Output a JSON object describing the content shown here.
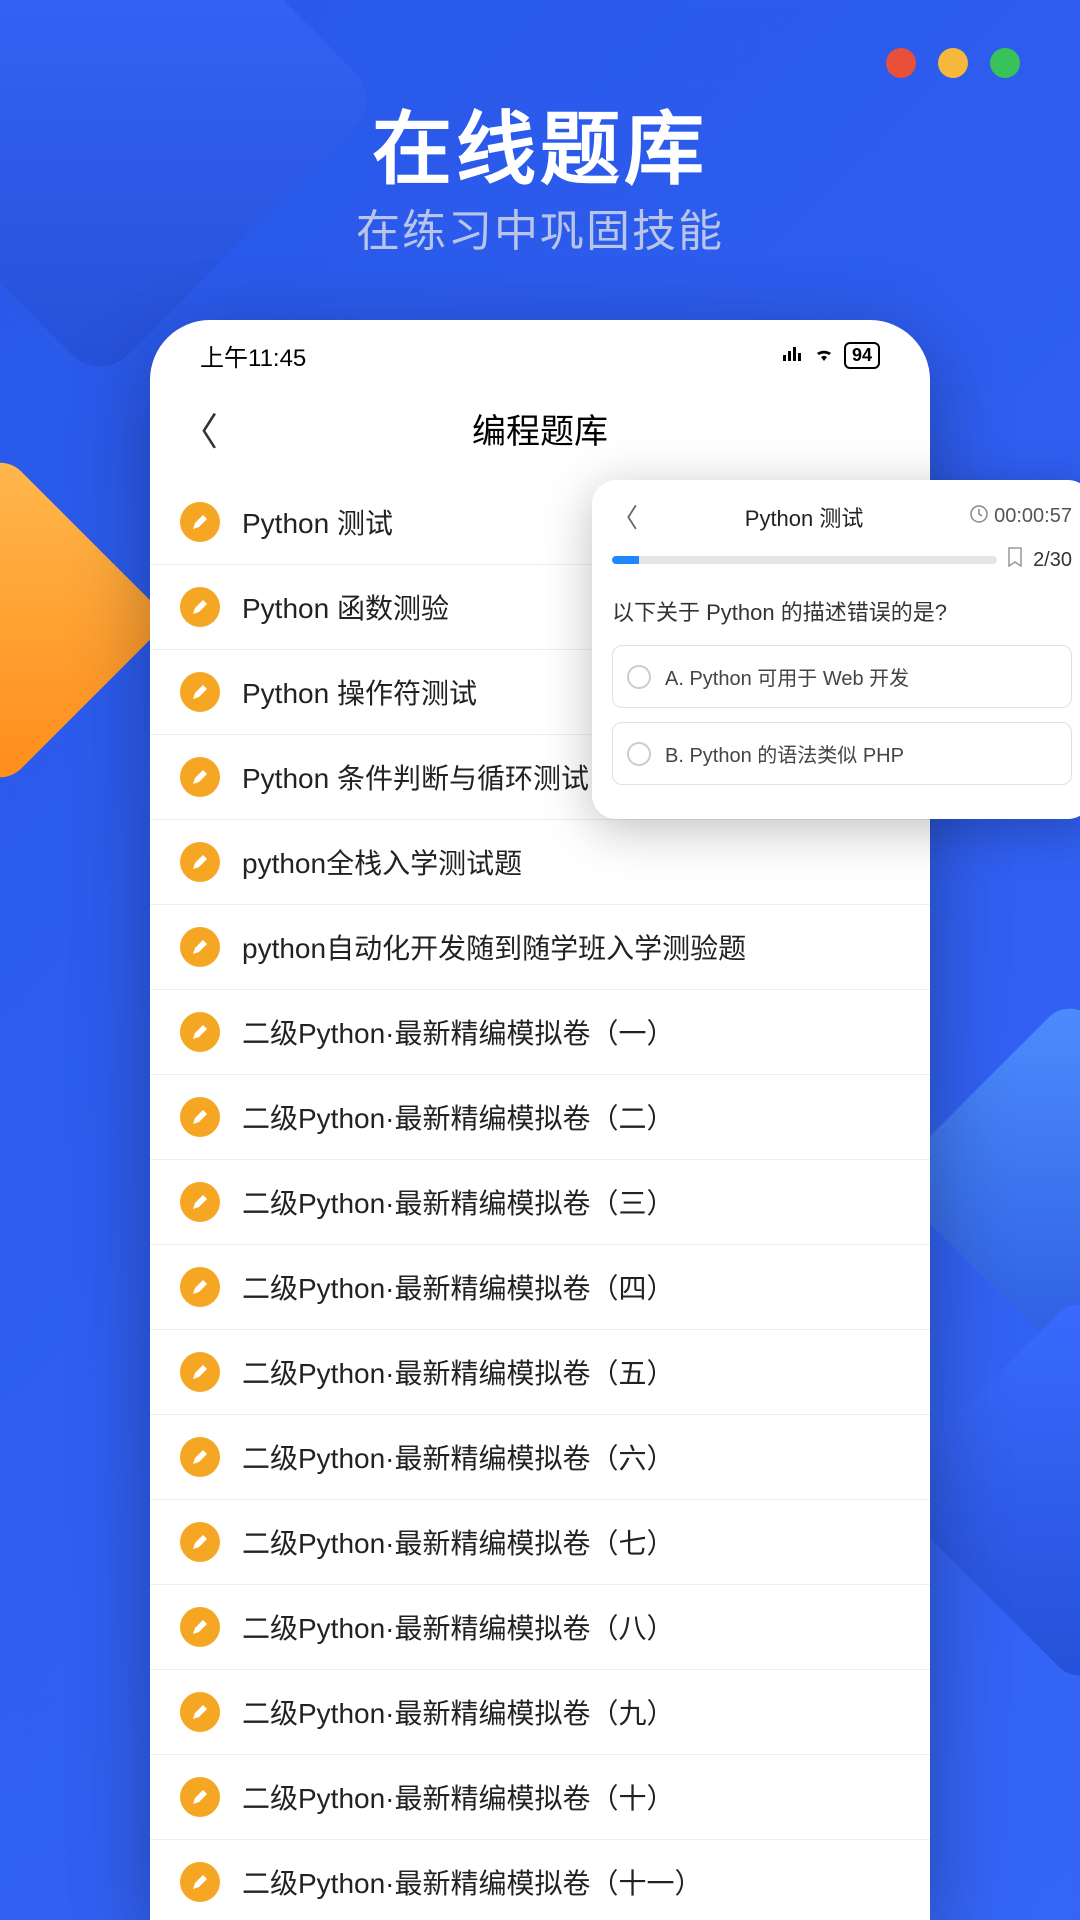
{
  "hero": {
    "title": "在线题库",
    "subtitle": "在练习中巩固技能"
  },
  "status": {
    "time": "上午11:45",
    "signal": "HD",
    "battery": "94"
  },
  "nav": {
    "title": "编程题库"
  },
  "list": [
    "Python 测试",
    "Python 函数测验",
    "Python 操作符测试",
    "Python 条件判断与循环测试",
    "python全栈入学测试题",
    "python自动化开发随到随学班入学测验题",
    "二级Python·最新精编模拟卷（一）",
    "二级Python·最新精编模拟卷（二）",
    "二级Python·最新精编模拟卷（三）",
    "二级Python·最新精编模拟卷（四）",
    "二级Python·最新精编模拟卷（五）",
    "二级Python·最新精编模拟卷（六）",
    "二级Python·最新精编模拟卷（七）",
    "二级Python·最新精编模拟卷（八）",
    "二级Python·最新精编模拟卷（九）",
    "二级Python·最新精编模拟卷（十）",
    "二级Python·最新精编模拟卷（十一）"
  ],
  "popup": {
    "title": "Python 测试",
    "timer": "00:00:57",
    "progress": "2/30",
    "question": "以下关于 Python 的描述错误的是?",
    "options": [
      "A. Python 可用于 Web 开发",
      "B. Python 的语法类似 PHP"
    ]
  }
}
